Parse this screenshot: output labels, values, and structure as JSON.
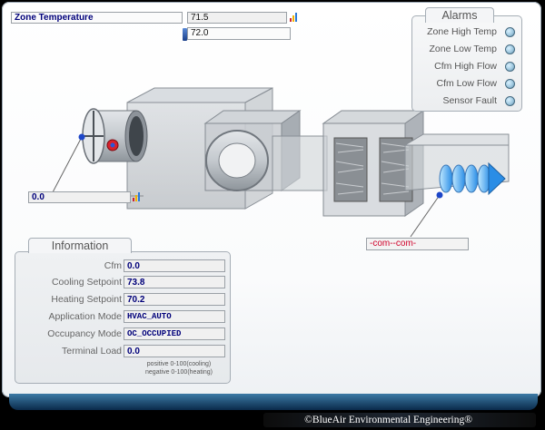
{
  "zone": {
    "label": "Zone Temperature",
    "value": "71.5",
    "setpoint": "72.0"
  },
  "damper": {
    "value": "0.0"
  },
  "com_status": "-com--com-",
  "alarms": {
    "title": "Alarms",
    "items": [
      {
        "label": "Zone High Temp"
      },
      {
        "label": "Zone Low Temp"
      },
      {
        "label": "Cfm High Flow"
      },
      {
        "label": "Cfm Low Flow"
      },
      {
        "label": "Sensor Fault"
      }
    ]
  },
  "information": {
    "title": "Information",
    "rows": [
      {
        "label": "Cfm",
        "value": "0.0"
      },
      {
        "label": "Cooling Setpoint",
        "value": "73.8"
      },
      {
        "label": "Heating Setpoint",
        "value": "70.2"
      },
      {
        "label": "Application Mode",
        "value": "HVAC_AUTO"
      },
      {
        "label": "Occupancy Mode",
        "value": "OC_OCCUPIED"
      },
      {
        "label": "Terminal Load",
        "value": "0.0"
      }
    ],
    "note_line1": "positive 0-100(cooling)",
    "note_line2": "negative 0-100(heating)"
  },
  "footer": {
    "copyright": "©BlueAir Environmental Engineering®"
  },
  "colors": {
    "value_text": "#00007a",
    "status_text": "#d0002a",
    "bar_blue": "#3c7ba6",
    "led": "#9fc8df"
  }
}
